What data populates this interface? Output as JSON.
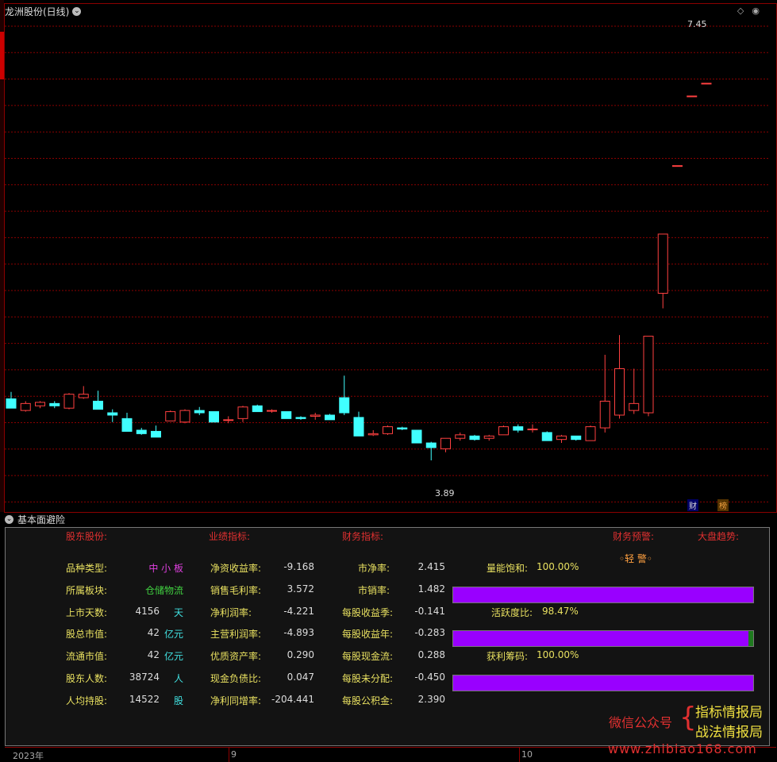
{
  "window": {
    "title": "龙洲股份(日线)"
  },
  "chart": {
    "high_label": "7.45",
    "low_label": "3.89",
    "tags": [
      "财",
      "榜"
    ]
  },
  "chart_data": {
    "type": "candlestick",
    "title": "龙洲股份(日线)",
    "ylim": [
      3.5,
      7.7
    ],
    "x_labels": [
      "2023年",
      "9",
      "10"
    ],
    "annotations": [
      {
        "text": "7.45"
      },
      {
        "text": "3.89"
      }
    ],
    "candles": [
      {
        "o": 4.42,
        "c": 4.34,
        "h": 4.48,
        "l": 4.34
      },
      {
        "o": 4.32,
        "c": 4.38,
        "h": 4.4,
        "l": 4.31
      },
      {
        "o": 4.36,
        "c": 4.39,
        "h": 4.4,
        "l": 4.34
      },
      {
        "o": 4.38,
        "c": 4.36,
        "h": 4.4,
        "l": 4.34
      },
      {
        "o": 4.34,
        "c": 4.46,
        "h": 4.47,
        "l": 4.33
      },
      {
        "o": 4.43,
        "c": 4.46,
        "h": 4.53,
        "l": 4.42
      },
      {
        "o": 4.4,
        "c": 4.33,
        "h": 4.49,
        "l": 4.33
      },
      {
        "o": 4.3,
        "c": 4.28,
        "h": 4.33,
        "l": 4.22
      },
      {
        "o": 4.25,
        "c": 4.14,
        "h": 4.3,
        "l": 4.14
      },
      {
        "o": 4.15,
        "c": 4.12,
        "h": 4.17,
        "l": 4.11
      },
      {
        "o": 4.14,
        "c": 4.09,
        "h": 4.19,
        "l": 4.09
      },
      {
        "o": 4.23,
        "c": 4.31,
        "h": 4.32,
        "l": 4.23
      },
      {
        "o": 4.22,
        "c": 4.32,
        "h": 4.33,
        "l": 4.21
      },
      {
        "o": 4.32,
        "c": 4.3,
        "h": 4.35,
        "l": 4.28
      },
      {
        "o": 4.31,
        "c": 4.22,
        "h": 4.31,
        "l": 4.22
      },
      {
        "o": 4.24,
        "c": 4.24,
        "h": 4.27,
        "l": 4.21
      },
      {
        "o": 4.25,
        "c": 4.35,
        "h": 4.36,
        "l": 4.22
      },
      {
        "o": 4.36,
        "c": 4.31,
        "h": 4.37,
        "l": 4.31
      },
      {
        "o": 4.32,
        "c": 4.32,
        "h": 4.33,
        "l": 4.3
      },
      {
        "o": 4.31,
        "c": 4.25,
        "h": 4.31,
        "l": 4.25
      },
      {
        "o": 4.26,
        "c": 4.25,
        "h": 4.27,
        "l": 4.24
      },
      {
        "o": 4.27,
        "c": 4.28,
        "h": 4.3,
        "l": 4.24
      },
      {
        "o": 4.28,
        "c": 4.24,
        "h": 4.29,
        "l": 4.24
      },
      {
        "o": 4.43,
        "c": 4.3,
        "h": 4.62,
        "l": 4.28
      },
      {
        "o": 4.26,
        "c": 4.1,
        "h": 4.31,
        "l": 4.1
      },
      {
        "o": 4.11,
        "c": 4.12,
        "h": 4.15,
        "l": 4.1
      },
      {
        "o": 4.12,
        "c": 4.18,
        "h": 4.19,
        "l": 4.11
      },
      {
        "o": 4.17,
        "c": 4.16,
        "h": 4.18,
        "l": 4.15
      },
      {
        "o": 4.15,
        "c": 4.04,
        "h": 4.15,
        "l": 4.04
      },
      {
        "o": 4.04,
        "c": 4.0,
        "h": 4.05,
        "l": 3.89
      },
      {
        "o": 3.99,
        "c": 4.08,
        "h": 4.08,
        "l": 3.96
      },
      {
        "o": 4.08,
        "c": 4.11,
        "h": 4.13,
        "l": 4.06
      },
      {
        "o": 4.1,
        "c": 4.07,
        "h": 4.11,
        "l": 4.06
      },
      {
        "o": 4.08,
        "c": 4.1,
        "h": 4.11,
        "l": 4.06
      },
      {
        "o": 4.11,
        "c": 4.18,
        "h": 4.19,
        "l": 4.11
      },
      {
        "o": 4.18,
        "c": 4.15,
        "h": 4.2,
        "l": 4.13
      },
      {
        "o": 4.16,
        "c": 4.16,
        "h": 4.2,
        "l": 4.13
      },
      {
        "o": 4.13,
        "c": 4.06,
        "h": 4.14,
        "l": 4.06
      },
      {
        "o": 4.07,
        "c": 4.1,
        "h": 4.11,
        "l": 4.04
      },
      {
        "o": 4.1,
        "c": 4.07,
        "h": 4.1,
        "l": 4.06
      },
      {
        "o": 4.06,
        "c": 4.18,
        "h": 4.19,
        "l": 4.06
      },
      {
        "o": 4.17,
        "c": 4.4,
        "h": 4.8,
        "l": 4.13
      },
      {
        "o": 4.28,
        "c": 4.68,
        "h": 4.97,
        "l": 4.25
      },
      {
        "o": 4.32,
        "c": 4.38,
        "h": 4.68,
        "l": 4.29
      },
      {
        "o": 4.3,
        "c": 4.96,
        "h": 4.96,
        "l": 4.27
      },
      {
        "o": 5.33,
        "c": 5.84,
        "h": 5.84,
        "l": 5.2
      },
      {
        "o": 6.43,
        "c": 6.43,
        "h": 6.43,
        "l": 6.43
      },
      {
        "o": 7.03,
        "c": 7.03,
        "h": 7.03,
        "l": 7.03
      },
      {
        "o": 7.14,
        "c": 7.14,
        "h": 7.14,
        "l": 7.14
      }
    ]
  },
  "panel": {
    "title": "基本面避险",
    "headers": {
      "holders": "股东股份:",
      "performance": "业绩指标:",
      "finance": "财务指标:",
      "warning": "财务预警:",
      "trend": "大盘趋势:"
    },
    "warning_value": "◦轻 警◦",
    "col1": [
      {
        "label": "品种类型:",
        "value": "中 小 板",
        "unit": "",
        "color": "#e040e0"
      },
      {
        "label": "所属板块:",
        "value": "仓储物流",
        "unit": "",
        "color": "#40d040"
      },
      {
        "label": "上市天数:",
        "value": "4156",
        "unit": "天",
        "color": "#dddddd"
      },
      {
        "label": "股总市值:",
        "value": "42",
        "unit": "亿元",
        "color": "#dddddd"
      },
      {
        "label": "流通市值:",
        "value": "42",
        "unit": "亿元",
        "color": "#dddddd"
      },
      {
        "label": "股东人数:",
        "value": "38724",
        "unit": "人",
        "color": "#dddddd"
      },
      {
        "label": "人均持股:",
        "value": "14522",
        "unit": "股",
        "color": "#dddddd"
      }
    ],
    "col2": [
      {
        "label": "净资收益率:",
        "value": "-9.168"
      },
      {
        "label": "销售毛利率:",
        "value": "3.572"
      },
      {
        "label": "净利润率:",
        "value": "-4.221"
      },
      {
        "label": "主营利润率:",
        "value": "-4.893"
      },
      {
        "label": "优质资产率:",
        "value": "0.290"
      },
      {
        "label": "现金负债比:",
        "value": "0.047"
      },
      {
        "label": "净利同增率:",
        "value": "-204.441"
      }
    ],
    "col3": [
      {
        "label": "市净率:",
        "value": "2.415"
      },
      {
        "label": "市销率:",
        "value": "1.482"
      },
      {
        "label": "每股收益季:",
        "value": "-0.141"
      },
      {
        "label": "每股收益年:",
        "value": "-0.283"
      },
      {
        "label": "每股现金流:",
        "value": "0.288"
      },
      {
        "label": "每股未分配:",
        "value": "-0.450"
      },
      {
        "label": "每股公积金:",
        "value": "2.390"
      }
    ],
    "meters": [
      {
        "label": "量能饱和:",
        "value": "100.00%",
        "fraction": 1.0
      },
      {
        "label": "活跃度比:",
        "value": "98.47%",
        "fraction": 0.9847
      },
      {
        "label": "获利筹码:",
        "value": "100.00%",
        "fraction": 1.0
      }
    ]
  },
  "axis": {
    "labels": [
      "2023年",
      "9",
      "10"
    ]
  },
  "watermark": {
    "wechat": "微信公众号",
    "brace": "{",
    "brand1": "指标情报局",
    "brand2": "战法情报局",
    "site": "www.zhibiao168.com"
  }
}
